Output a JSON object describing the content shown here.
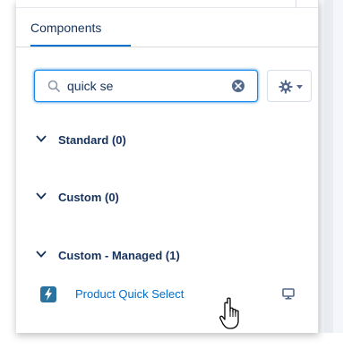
{
  "panel": {
    "tabs": [
      {
        "label": "Components",
        "active": true
      }
    ]
  },
  "search": {
    "value": "quick se",
    "placeholder": ""
  },
  "sections": [
    {
      "label": "Standard (0)"
    },
    {
      "label": "Custom (0)"
    },
    {
      "label": "Custom - Managed (1)"
    }
  ],
  "items": [
    {
      "label": "Product Quick Select",
      "icon": "lightning-icon",
      "action_icon": "desktop-icon"
    }
  ],
  "colors": {
    "accent": "#0070d2",
    "link": "#006dcc",
    "text": "#16325c",
    "icon_bg": "#2a739e"
  }
}
